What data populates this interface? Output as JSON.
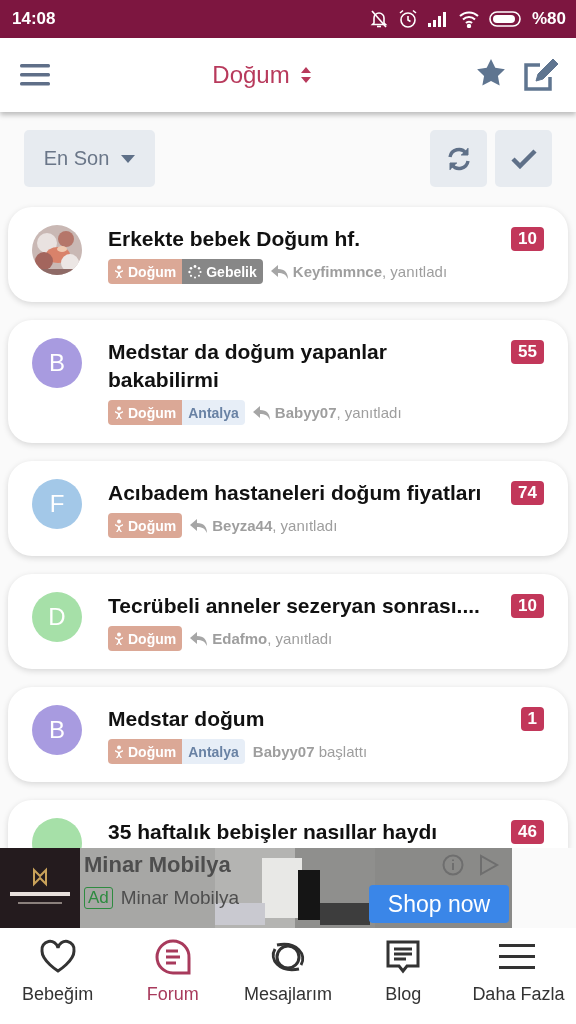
{
  "status_bar": {
    "time": "14:08",
    "battery": "%80"
  },
  "header": {
    "title": "Doğum"
  },
  "filter": {
    "sort": "En Son"
  },
  "topics": [
    {
      "title": "Erkekte bebek Doğum hf.",
      "count": "10",
      "tags": [
        {
          "kind": "birth",
          "label": "Doğum"
        },
        {
          "kind": "pregnancy",
          "label": "Gebelik"
        }
      ],
      "user": "Keyfimmnce",
      "action": ", yanıtladı",
      "replied": true
    },
    {
      "avatar": {
        "kind": "letter",
        "letter": "B",
        "color": "#a89be0"
      },
      "title": "Medstar da doğum yapanlar bakabilirmi",
      "count": "55",
      "tags": [
        {
          "kind": "birth",
          "label": "Doğum"
        },
        {
          "kind": "city",
          "label": "Antalya"
        }
      ],
      "user": "Babyy07",
      "action": ", yanıtladı",
      "replied": true
    },
    {
      "avatar": {
        "kind": "letter",
        "letter": "F",
        "color": "#a3c8e8"
      },
      "title": "Acıbadem hastaneleri doğum fiyatları",
      "count": "74",
      "tags": [
        {
          "kind": "birth",
          "label": "Doğum"
        }
      ],
      "user": "Beyza44",
      "action": ", yanıtladı",
      "replied": true
    },
    {
      "avatar": {
        "kind": "letter",
        "letter": "D",
        "color": "#a6e0a8"
      },
      "title": "Tecrübeli anneler sezeryan sonrası....",
      "count": "10",
      "tags": [
        {
          "kind": "birth",
          "label": "Doğum"
        }
      ],
      "user": "Edafmo",
      "action": ", yanıtladı",
      "replied": true
    },
    {
      "avatar": {
        "kind": "letter",
        "letter": "B",
        "color": "#a89be0"
      },
      "title": "Medstar doğum",
      "count": "1",
      "tags": [
        {
          "kind": "birth",
          "label": "Doğum"
        },
        {
          "kind": "city",
          "label": "Antalya"
        }
      ],
      "user": "Babyy07",
      "action": " başlattı",
      "replied": false
    },
    {
      "avatar": {
        "kind": "letter",
        "color": "#a6e0a8"
      },
      "title": "35 haftalık bebişler nasıllar haydı",
      "count": "46"
    }
  ],
  "ad": {
    "headline": "Minar Mobilya",
    "badge": "Ad",
    "advertiser": "Minar Mobilya",
    "cta": "Shop now"
  },
  "nav": [
    {
      "label": "Bebeğim",
      "selected": false
    },
    {
      "label": "Forum",
      "selected": true
    },
    {
      "label": "Mesajlarım",
      "selected": false
    },
    {
      "label": "Blog",
      "selected": false
    },
    {
      "label": "Daha Fazla",
      "selected": false
    }
  ]
}
